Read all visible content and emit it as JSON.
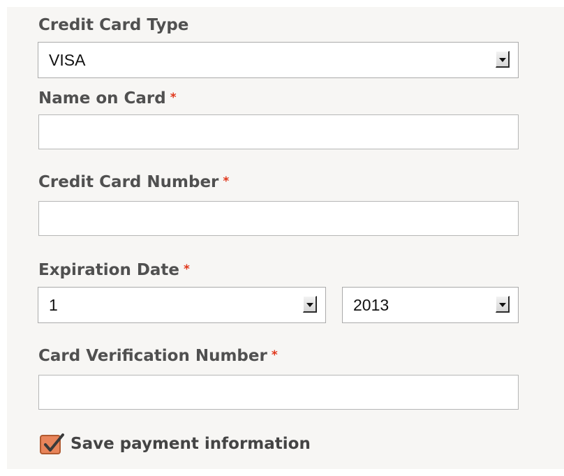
{
  "form": {
    "card_type": {
      "label": "Credit Card Type",
      "selected": "VISA"
    },
    "name_on_card": {
      "label": "Name on Card",
      "required_marker": "*",
      "value": ""
    },
    "card_number": {
      "label": "Credit Card Number",
      "required_marker": "*",
      "value": ""
    },
    "expiration": {
      "label": "Expiration Date",
      "required_marker": "*",
      "month_selected": "1",
      "year_selected": "2013"
    },
    "cvv": {
      "label": "Card Verification Number",
      "required_marker": "*",
      "value": ""
    },
    "save_payment": {
      "label": "Save payment information",
      "checked": true
    }
  },
  "colors": {
    "required_marker": "#e0361a",
    "checkbox_fill": "#e8845a",
    "panel_background": "#f7f6f4"
  }
}
